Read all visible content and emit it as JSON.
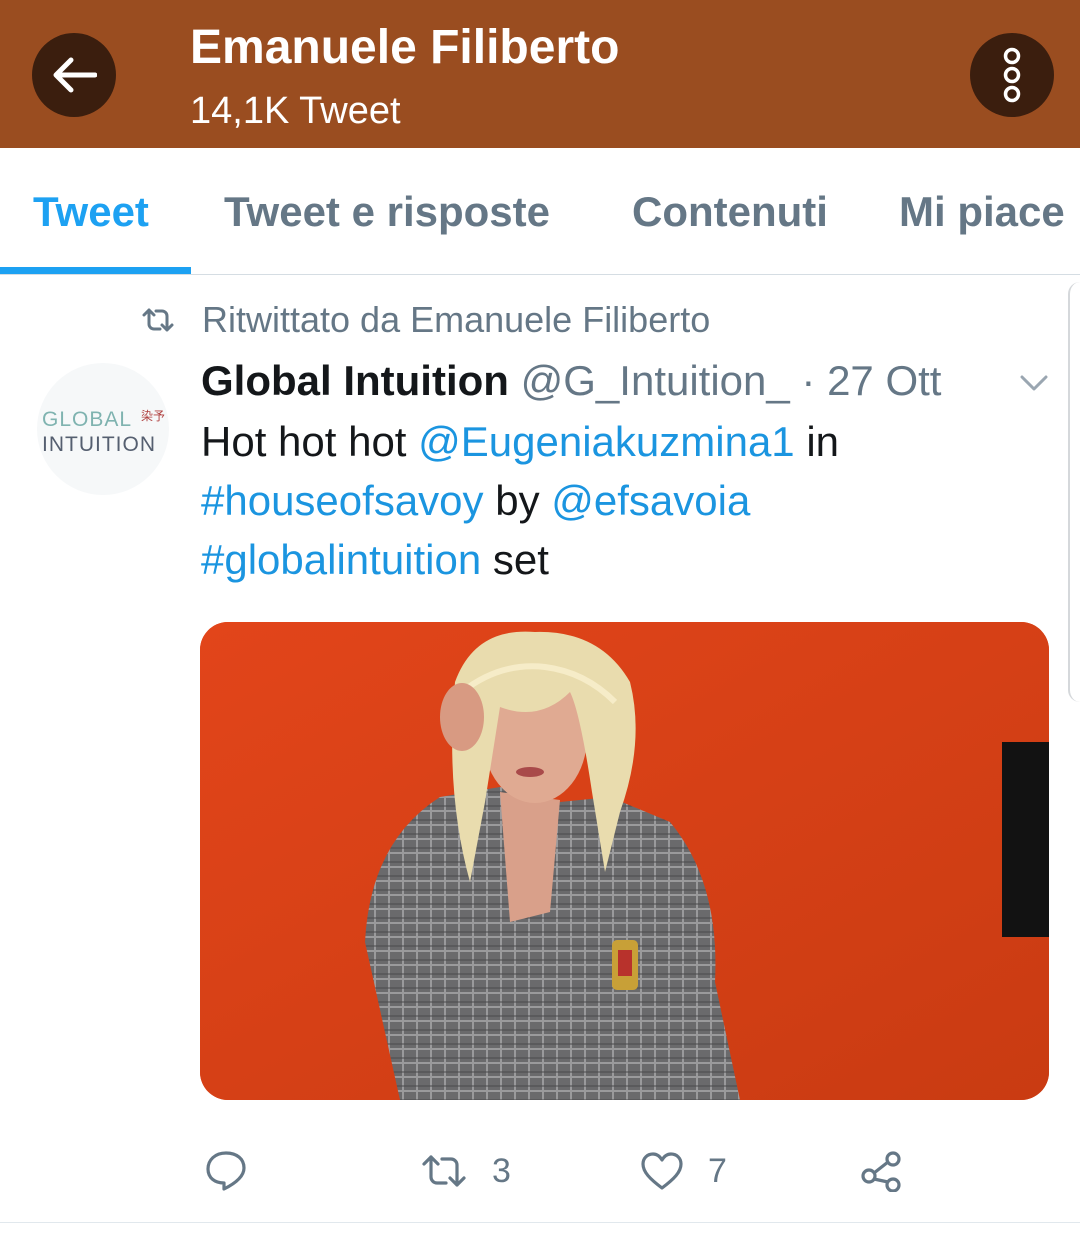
{
  "header": {
    "name": "Emanuele Filiberto",
    "tweet_count": "14,1K Tweet",
    "back_icon": "arrow-left-icon",
    "more_icon": "more-vertical-icon",
    "bar_color": "#9a4d20"
  },
  "tabs": [
    {
      "label": "Tweet",
      "active": true
    },
    {
      "label": "Tweet e risposte",
      "active": false
    },
    {
      "label": "Contenuti",
      "active": false
    },
    {
      "label": "Mi piace",
      "active": false
    }
  ],
  "tweet": {
    "retweeted_by": "Ritwittato da Emanuele Filiberto",
    "avatar": {
      "line1": "GLOBAL",
      "glyph": "染予",
      "line2": "INTUITION"
    },
    "author_name": "Global Intuition",
    "meta": "@G_Intuition_ · 27 Ott",
    "text": {
      "t1": "Hot hot hot ",
      "mention1": "@Eugeniakuzmina1",
      "t2": " in",
      "hashtag1": "#houseofsavoy",
      "t3": " by ",
      "mention2": "@efsavoia",
      "hashtag2": "#globalintuition",
      "t4": " set"
    },
    "media_icon": "photo-model-blazer",
    "actions": {
      "reply_icon": "reply-icon",
      "retweet_icon": "retweet-icon",
      "retweet_count": "3",
      "like_icon": "heart-icon",
      "like_count": "7",
      "share_icon": "share-icon"
    }
  },
  "colors": {
    "accent": "#1da1f2",
    "link": "#1b95e0",
    "muted": "#657786"
  }
}
